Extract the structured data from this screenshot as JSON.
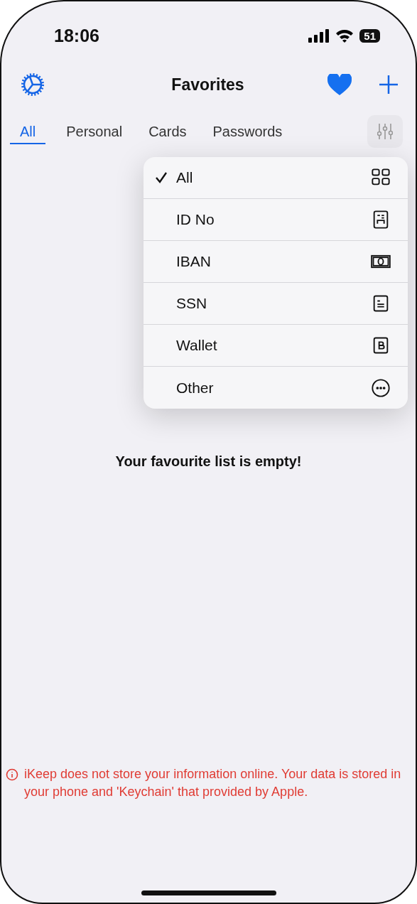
{
  "status_bar": {
    "time": "18:06",
    "battery": "51"
  },
  "nav": {
    "title": "Favorites"
  },
  "tabs": [
    {
      "label": "All",
      "selected": true
    },
    {
      "label": "Personal",
      "selected": false
    },
    {
      "label": "Cards",
      "selected": false
    },
    {
      "label": "Passwords",
      "selected": false
    }
  ],
  "filter_menu": {
    "items": [
      {
        "label": "All",
        "selected": true,
        "kind": "grid"
      },
      {
        "label": "ID No",
        "selected": false,
        "kind": "id"
      },
      {
        "label": "IBAN",
        "selected": false,
        "kind": "money"
      },
      {
        "label": "SSN",
        "selected": false,
        "kind": "ssn"
      },
      {
        "label": "Wallet",
        "selected": false,
        "kind": "wallet"
      },
      {
        "label": "Other",
        "selected": false,
        "kind": "more"
      }
    ]
  },
  "empty_message": "Your favourite list is empty!",
  "notice": "iKeep does not store your information online. Your data is stored in your phone and 'Keychain' that provided by Apple."
}
